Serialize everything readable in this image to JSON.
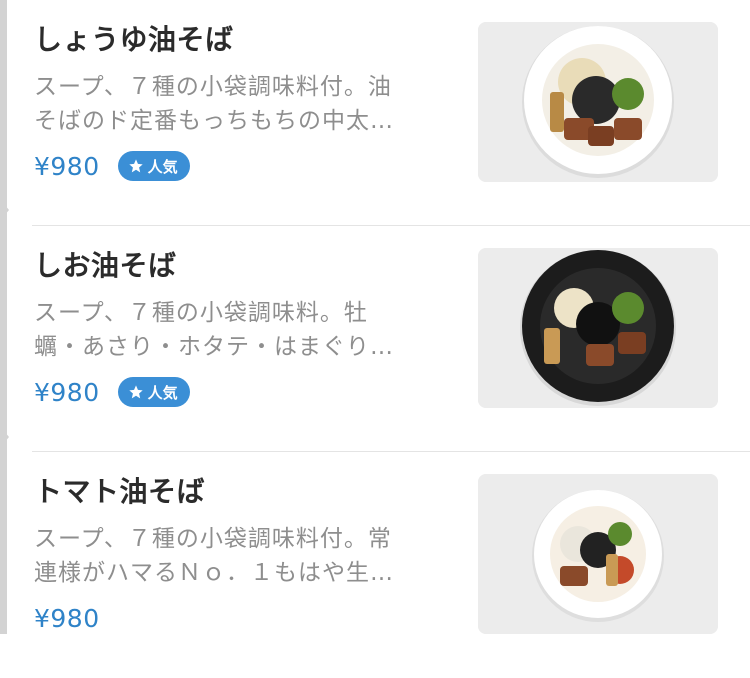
{
  "menu_items": [
    {
      "title": "しょうゆ油そば",
      "description_lines": [
        "スープ、７種の小袋調味料付。油",
        "そばのド定番もっちもちの中太…"
      ],
      "price": "¥980",
      "badge": "人気",
      "image_bowl": "white-bowl"
    },
    {
      "title": "しお油そば",
      "description_lines": [
        "スープ、７種の小袋調味料。牡",
        "蠣・あさり・ホタテ・はまぐり…"
      ],
      "price": "¥980",
      "badge": "人気",
      "image_bowl": "black-bowl"
    },
    {
      "title": "トマト油そば",
      "description_lines": [
        "スープ、７種の小袋調味料付。常",
        "連様がハマるＮｏ．１もはや生…"
      ],
      "price": "¥980",
      "badge": null,
      "image_bowl": "white-bowl"
    }
  ],
  "colors": {
    "price": "#2f83c8",
    "badge_bg": "#3b8fd6",
    "title": "#2b2b2b",
    "description": "#8e8e8e"
  },
  "icons": {
    "badge_icon": "star-icon"
  }
}
